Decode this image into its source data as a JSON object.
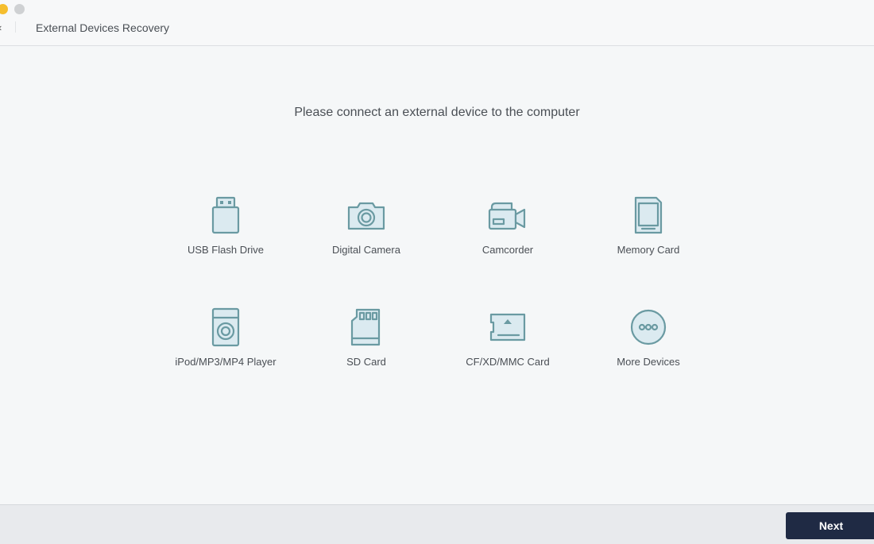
{
  "window": {
    "title": "External Devices Recovery",
    "controls": [
      "minimize",
      "zoom"
    ],
    "back_icon": "back-arrow-icon"
  },
  "main": {
    "prompt": "Please connect an external device to the computer",
    "devices": [
      {
        "label": "USB Flash Drive",
        "icon": "usb-flash-drive-icon"
      },
      {
        "label": "Digital Camera",
        "icon": "camera-icon"
      },
      {
        "label": "Camcorder",
        "icon": "camcorder-icon"
      },
      {
        "label": "Memory Card",
        "icon": "memory-card-icon"
      },
      {
        "label": "iPod/MP3/MP4 Player",
        "icon": "media-player-icon"
      },
      {
        "label": "SD Card",
        "icon": "sd-card-icon"
      },
      {
        "label": "CF/XD/MMC Card",
        "icon": "cf-card-icon"
      },
      {
        "label": "More Devices",
        "icon": "more-icon"
      }
    ]
  },
  "footer": {
    "next_label": "Next"
  },
  "colors": {
    "icon_stroke": "#6a9aa2",
    "icon_fill": "#dbeaf0",
    "next_button": "#1f2a44",
    "background": "#f5f7f8"
  }
}
